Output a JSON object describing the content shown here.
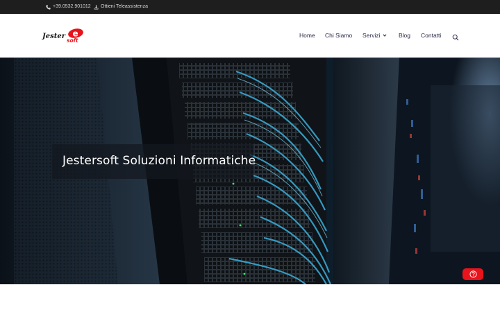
{
  "topbar": {
    "phone": "+39.0532.901012",
    "assistance": "Ottieni Teleassistenza",
    "phone_icon": "phone-icon",
    "download_icon": "download-icon"
  },
  "header": {
    "logo_text_main": "Jester",
    "logo_text_badge": "e",
    "logo_text_sub": "soft",
    "brand_color": "#e8131b",
    "nav": {
      "home": "Home",
      "chi_siamo": "Chi Siamo",
      "servizi": "Servizi",
      "blog": "Blog",
      "contatti": "Contatti"
    },
    "search_icon": "search-icon"
  },
  "hero": {
    "title": "Jestersoft Soluzioni Informatiche",
    "image": "server-rack-photo"
  },
  "help_button": {
    "icon": "help-icon",
    "color": "#e8131b"
  }
}
